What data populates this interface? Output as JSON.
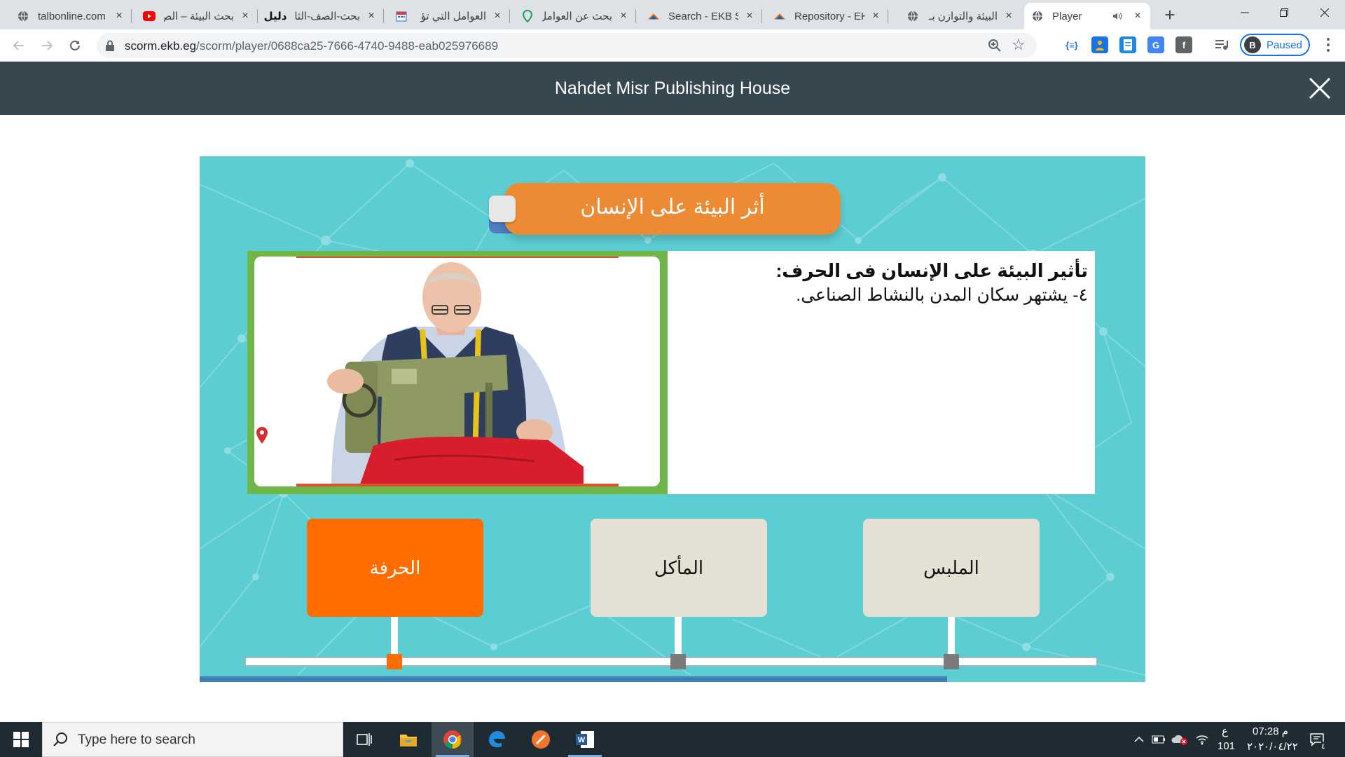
{
  "browser": {
    "tabs": [
      {
        "title": "talbonline.com",
        "icon": "globe-icon",
        "active": false
      },
      {
        "title": "بحث البيئة – الص",
        "icon": "youtube-icon",
        "active": false
      },
      {
        "title": "بحث-الصف-الثا",
        "icon": "dalil-icon",
        "active": false
      },
      {
        "title": "العوامل التي تؤ",
        "icon": "calendar-icon",
        "active": false
      },
      {
        "title": "بحث عن العوامل",
        "icon": "pin-icon",
        "active": false
      },
      {
        "title": "Search - EKB St",
        "icon": "ekb-icon",
        "active": false
      },
      {
        "title": "Repository - EK",
        "icon": "ekb-icon",
        "active": false
      },
      {
        "title": "البيئة والتوازن بـ",
        "icon": "globe-icon",
        "active": false
      },
      {
        "title": "Player",
        "icon": "globe-icon",
        "active": true
      }
    ],
    "url_host": "scorm.ekb.eg",
    "url_path": "/scorm/player/0688ca25-7666-4740-9488-eab025976689",
    "profile_initial": "B",
    "profile_status": "Paused"
  },
  "player": {
    "header_title": "Nahdet Misr Publishing House"
  },
  "lesson": {
    "title": "أثر البيئة على الإنسان",
    "heading": "تأثير البيئة على الإنسان فى الحرف:",
    "body": "٤- يشتهر سكان المدن بالنشاط الصناعى.",
    "categories": [
      {
        "label": "الحرفة",
        "active": true
      },
      {
        "label": "المأكل",
        "active": false
      },
      {
        "label": "الملبس",
        "active": false
      }
    ],
    "progress_fraction": 0.79,
    "colors": {
      "stage_bg": "#5ccdd2",
      "banner": "#ed8b35",
      "active_button": "#ff6d00",
      "idle_button": "#e4e0d4",
      "frame": "#6fb548",
      "progress": "#3f7fb5"
    }
  },
  "taskbar": {
    "search_placeholder": "Type here to search",
    "ime": "ع",
    "ime_sub": "101",
    "time": "07:28 م",
    "date": "٢٠٢٠/٠٤/٢٢",
    "notification_badge": "٤"
  }
}
